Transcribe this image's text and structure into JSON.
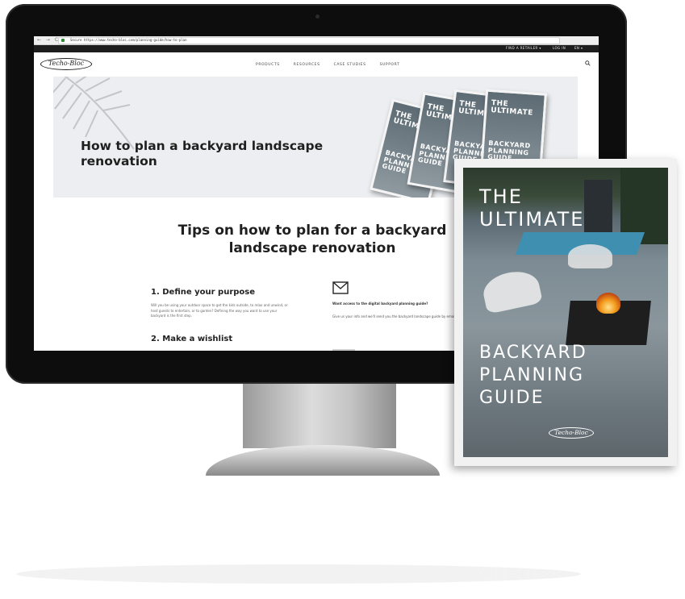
{
  "browser": {
    "url": "Secure  https://www.techo-bloc.com/planning-guide/how-to-plan",
    "nav_glyphs": "← → C"
  },
  "site": {
    "logo": "Techo-Bloc",
    "utility": [
      "FIND A RETAILER ▾",
      "LOG IN",
      "EN ▾"
    ],
    "nav": [
      "PRODUCTS",
      "RESOURCES",
      "CASE STUDIES",
      "SUPPORT"
    ]
  },
  "hero": {
    "title": "How to plan a backyard landscape renovation"
  },
  "tips": {
    "title": "Tips on how to plan for a backyard landscape renovation",
    "step1_heading": "1. Define your purpose",
    "step1_body": "Will you be using your outdoor space to get the kids outside, to relax and unwind, or host guests to entertain, or to garden? Defining the way you want to use your backyard is the first step.",
    "step2_heading": "2. Make a wishlist",
    "cta_question": "Want access to the digital backyard planning guide?",
    "cta_body": "Give us your info and we'll send you the backyard landscape guide by email!"
  },
  "guide": {
    "title_line1": "THE",
    "title_line2": "ULTIMATE",
    "subtitle_line1": "BACKYARD",
    "subtitle_line2": "PLANNING",
    "subtitle_line3": "GUIDE",
    "logo": "Techo-Bloc",
    "mini_top": "THE ULTIMATE",
    "mini_bottom": "BACKYARD PLANNING GUIDE"
  },
  "colors": {
    "utility_bar": "#1d1d1d",
    "hero_bg": "#eceef1",
    "pool": "#3e8fb0",
    "secure_green": "#2e8b3a"
  },
  "icons": [
    "search-icon",
    "envelope-icon",
    "lock-icon",
    "palm-leaf-icon"
  ]
}
